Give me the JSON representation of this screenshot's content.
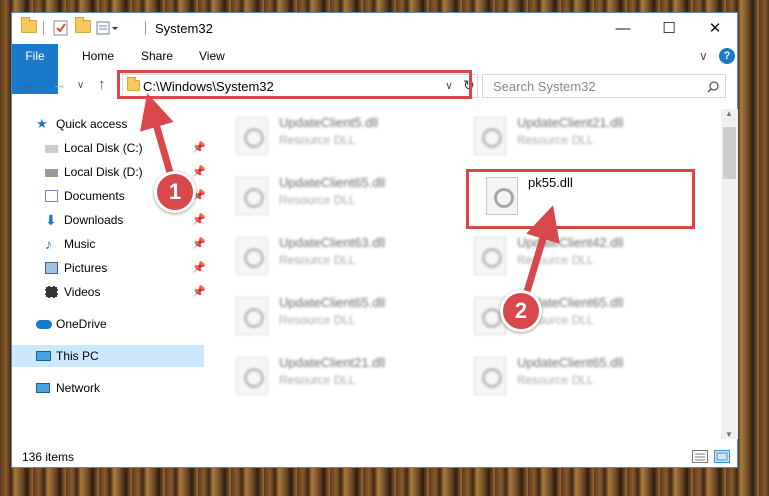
{
  "window": {
    "title": "System32",
    "controls": {
      "minimize": "—",
      "maximize": "☐",
      "close": "✕"
    }
  },
  "ribbon": {
    "tabs": [
      "File",
      "Home",
      "Share",
      "View"
    ],
    "collapse_icon": "∨",
    "help_icon": "?"
  },
  "addressbar": {
    "path": "C:\\Windows\\System32",
    "search_placeholder": "Search System32"
  },
  "navpane": {
    "items": [
      {
        "label": "Quick access",
        "icon": "star-icon"
      },
      {
        "label": "Local Disk (C:)",
        "icon": "drive-icon",
        "pinned": true
      },
      {
        "label": "Local Disk (D:)",
        "icon": "drive-icon",
        "pinned": true
      },
      {
        "label": "Documents",
        "icon": "documents-icon",
        "pinned": true
      },
      {
        "label": "Downloads",
        "icon": "downloads-icon",
        "pinned": true
      },
      {
        "label": "Music",
        "icon": "music-icon",
        "pinned": true
      },
      {
        "label": "Pictures",
        "icon": "pictures-icon",
        "pinned": true
      },
      {
        "label": "Videos",
        "icon": "videos-icon",
        "pinned": true
      },
      {
        "label": "OneDrive",
        "icon": "cloud-icon"
      },
      {
        "label": "This PC",
        "icon": "pc-icon",
        "selected": true
      },
      {
        "label": "Network",
        "icon": "network-icon"
      }
    ]
  },
  "files": [
    {
      "name": "UpdateClient5.dll",
      "type": "Resource DLL"
    },
    {
      "name": "UpdateClient21.dll",
      "type": "Resource DLL"
    },
    {
      "name": "UpdateClient65.dll",
      "type": "Resource DLL"
    },
    {
      "name": "pk55.dll",
      "type": ""
    },
    {
      "name": "UpdateClient63.dll",
      "type": "Resource DLL"
    },
    {
      "name": "UpdateClient42.dll",
      "type": "Resource DLL"
    },
    {
      "name": "UpdateClient65.dll",
      "type": "Resource DLL"
    },
    {
      "name": "UpdateClient65.dll",
      "type": "Resource DLL"
    },
    {
      "name": "UpdateClient21.dll",
      "type": "Resource DLL"
    },
    {
      "name": "UpdateClient65.dll",
      "type": "Resource DLL"
    }
  ],
  "status": {
    "count": "136 items"
  },
  "annotations": {
    "step1": "1",
    "step2": "2"
  },
  "colors": {
    "highlight": "#d8474a",
    "file_tab": "#1979ca",
    "selection": "#cce8ff"
  }
}
